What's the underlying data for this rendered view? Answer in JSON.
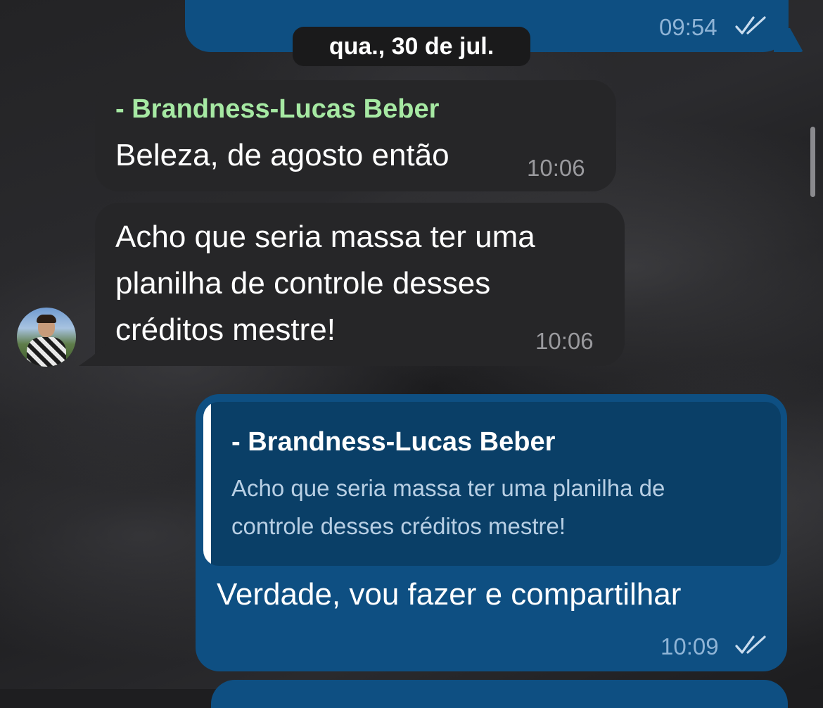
{
  "date_separator": "qua., 30 de jul.",
  "messages": [
    {
      "direction": "outgoing",
      "partial": true,
      "time": "09:54",
      "status": "read-double-check"
    },
    {
      "direction": "incoming",
      "sender": "- Brandness-Lucas Beber",
      "text": "Beleza, de agosto então",
      "time": "10:06"
    },
    {
      "direction": "incoming",
      "text_lines": [
        "Acho que seria massa ter uma",
        "planilha de controle desses",
        "créditos mestre!"
      ],
      "time": "10:06",
      "avatar": "user-avatar"
    },
    {
      "direction": "outgoing",
      "reply_to": {
        "sender": "- Brandness-Lucas Beber",
        "text_lines": [
          "Acho que seria massa ter uma planilha de",
          "controle desses créditos mestre!"
        ]
      },
      "text": "Verdade, vou fazer e compartilhar",
      "time": "10:09",
      "status": "read-double-check"
    }
  ],
  "colors": {
    "outgoing_bubble": "#0e4f82",
    "incoming_bubble": "#262628",
    "sender_name": "#a6e9a3",
    "quote_bar": "#ffffff"
  }
}
